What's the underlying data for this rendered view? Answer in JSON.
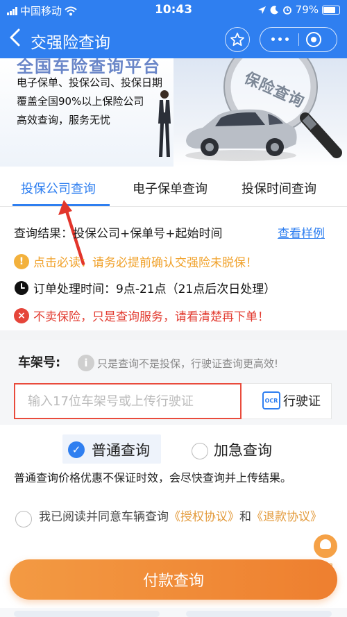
{
  "status_bar": {
    "carrier": "中国移动",
    "time": "10:43",
    "battery": "79%"
  },
  "nav": {
    "back": "<",
    "title": "交强险查询"
  },
  "banner": {
    "headline": "全国车险查询平台",
    "lines": [
      "电子保单、投保公司、投保日期",
      "覆盖全国90%以上保险公司",
      "高效查询，服务无忧"
    ],
    "magnifier_text": "保险查询"
  },
  "tabs": [
    {
      "label": "投保公司查询",
      "active": true
    },
    {
      "label": "电子保单查询",
      "active": false
    },
    {
      "label": "投保时间查询",
      "active": false
    }
  ],
  "result": {
    "text": "查询结果：投保公司+保单号+起始时间",
    "sample_link": "查看样例"
  },
  "notices": [
    {
      "icon": "warning-icon",
      "text": "点击必读：请务必提前确认交强险未脱保！",
      "color": "#f0a12a"
    },
    {
      "icon": "clock-icon",
      "text": "订单处理时间：9点-21点（21点后次日处理）",
      "color": "#111111"
    },
    {
      "icon": "error-icon",
      "text": "不卖保险，只是查询服务，请看清楚再下单！",
      "color": "#e23b30"
    }
  ],
  "vin": {
    "label": "车架号:",
    "hint": "只是查询不是投保，行驶证查询更高效!",
    "placeholder": "输入17位车架号或上传行驶证",
    "value": "",
    "ocr_label": "行驶证",
    "ocr_icon_text": "OCR"
  },
  "options": {
    "normal": "普通查询",
    "urgent": "加急查询",
    "selected": "normal"
  },
  "note": "普通查询价格优惠不保证时效，会尽快查询并上传结果。",
  "agreement": {
    "prefix": "我已阅读并同意车辆查询",
    "auth_link": "《授权协议》",
    "and": "和",
    "refund_link": "《退款协议》"
  },
  "service_label": "客服",
  "pay_button": "付款查询",
  "colors": {
    "primary": "#2f7ff0",
    "accent": "#ee7f2f",
    "danger": "#e23b30",
    "warning": "#f0a12a"
  }
}
